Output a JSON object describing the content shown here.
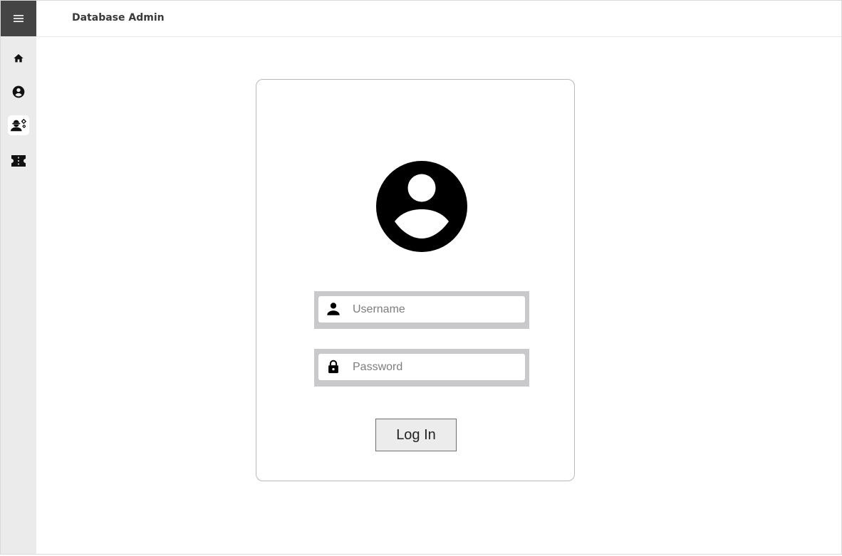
{
  "header": {
    "title": "Database Admin"
  },
  "sidebar": {
    "menu_icon": "hamburger-menu-icon",
    "items": [
      {
        "icon": "home-icon",
        "active": false
      },
      {
        "icon": "account-circle-icon",
        "active": false
      },
      {
        "icon": "engineer-gear-icon",
        "active": true
      },
      {
        "icon": "ticket-icon",
        "active": false
      }
    ],
    "background_color": "#ebebeb",
    "menu_button_color": "#444444"
  },
  "login": {
    "avatar_icon": "account-circle-icon",
    "username": {
      "placeholder": "Username",
      "value": "",
      "icon": "person-icon"
    },
    "password": {
      "placeholder": "Password",
      "value": "",
      "icon": "lock-icon"
    },
    "submit_label": "Log In"
  }
}
